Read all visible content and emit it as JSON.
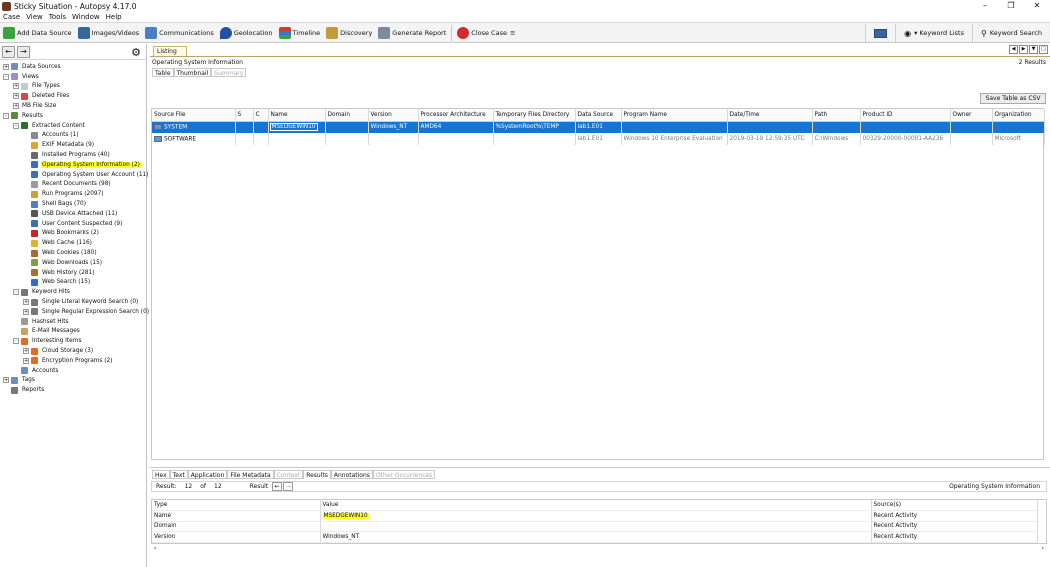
{
  "window": {
    "title": "Sticky Situation - Autopsy 4.17.0",
    "controls": [
      "–",
      "❐",
      "✕"
    ]
  },
  "menu": [
    "Case",
    "View",
    "Tools",
    "Window",
    "Help"
  ],
  "toolbar": {
    "buttons": [
      {
        "label": "Add Data Source",
        "icon": "add-data-source-icon",
        "color": "#3aa23a"
      },
      {
        "label": "Images/Videos",
        "icon": "images-icon",
        "color": "#37659e"
      },
      {
        "label": "Communications",
        "icon": "communications-icon",
        "color": "#4a7fc4"
      },
      {
        "label": "Geolocation",
        "icon": "geolocation-icon",
        "color": "#2450a4"
      },
      {
        "label": "Timeline",
        "icon": "timeline-icon",
        "color": "#d23d2a"
      },
      {
        "label": "Discovery",
        "icon": "discovery-icon",
        "color": "#c49b3a"
      },
      {
        "label": "Generate Report",
        "icon": "report-icon",
        "color": "#7c8a9a"
      },
      {
        "label": "Close Case",
        "icon": "close-case-icon",
        "color": "#d22b2b"
      }
    ],
    "keyword_lists": "Keyword Lists",
    "keyword_search": "Keyword Search"
  },
  "tree": [
    {
      "label": "Data Sources",
      "level": 0,
      "exp": "+",
      "color": "#6f8fc2"
    },
    {
      "label": "Views",
      "level": 0,
      "exp": "-",
      "color": "#9c8cc8"
    },
    {
      "label": "File Types",
      "level": 1,
      "exp": "+",
      "color": "#c9c9c9"
    },
    {
      "label": "Deleted Files",
      "level": 1,
      "exp": "+",
      "color": "#d44"
    },
    {
      "label": "MB File Size",
      "level": 1,
      "exp": "+",
      "color": ""
    },
    {
      "label": "Results",
      "level": 0,
      "exp": "-",
      "color": "#5a8c3a"
    },
    {
      "label": "Extracted Content",
      "level": 1,
      "exp": "-",
      "color": "#2f6e2f"
    },
    {
      "label": "Accounts (1)",
      "level": 2,
      "exp": "",
      "color": "#8a8a8a"
    },
    {
      "label": "EXIF Metadata (9)",
      "level": 2,
      "exp": "",
      "color": "#d9a63a"
    },
    {
      "label": "Installed Programs (40)",
      "level": 2,
      "exp": "",
      "color": "#6b6b6b"
    },
    {
      "label": "Operating System Information (2)",
      "level": 2,
      "exp": "",
      "color": "#3d6fb0",
      "hl": true
    },
    {
      "label": "Operating System User Account (11)",
      "level": 2,
      "exp": "",
      "color": "#3d6fb0"
    },
    {
      "label": "Recent Documents (98)",
      "level": 2,
      "exp": "",
      "color": "#9a9a9a"
    },
    {
      "label": "Run Programs (2097)",
      "level": 2,
      "exp": "",
      "color": "#c9a03a"
    },
    {
      "label": "Shell Bags (70)",
      "level": 2,
      "exp": "",
      "color": "#4a7fc4"
    },
    {
      "label": "USB Device Attached (11)",
      "level": 2,
      "exp": "",
      "color": "#555"
    },
    {
      "label": "User Content Suspected (9)",
      "level": 2,
      "exp": "",
      "color": "#3d6fb0"
    },
    {
      "label": "Web Bookmarks (2)",
      "level": 2,
      "exp": "",
      "color": "#c02a2a"
    },
    {
      "label": "Web Cache (116)",
      "level": 2,
      "exp": "",
      "color": "#e0b12a"
    },
    {
      "label": "Web Cookies (180)",
      "level": 2,
      "exp": "",
      "color": "#a86a2e"
    },
    {
      "label": "Web Downloads (15)",
      "level": 2,
      "exp": "",
      "color": "#7aa04a"
    },
    {
      "label": "Web History (281)",
      "level": 2,
      "exp": "",
      "color": "#a0742e"
    },
    {
      "label": "Web Search (15)",
      "level": 2,
      "exp": "",
      "color": "#2a6fd2"
    },
    {
      "label": "Keyword Hits",
      "level": 1,
      "exp": "-",
      "color": "#777"
    },
    {
      "label": "Single Literal Keyword Search (0)",
      "level": 2,
      "exp": "+",
      "color": "#777"
    },
    {
      "label": "Single Regular Expression Search (0)",
      "level": 2,
      "exp": "+",
      "color": "#777"
    },
    {
      "label": "Hashset Hits",
      "level": 1,
      "exp": "",
      "color": "#9a9a9a"
    },
    {
      "label": "E-Mail Messages",
      "level": 1,
      "exp": "",
      "color": "#c8a060"
    },
    {
      "label": "Interesting Items",
      "level": 1,
      "exp": "-",
      "color": "#e66b1f"
    },
    {
      "label": "Cloud Storage (3)",
      "level": 2,
      "exp": "+",
      "color": "#e66b1f"
    },
    {
      "label": "Encryption Programs (2)",
      "level": 2,
      "exp": "+",
      "color": "#e66b1f"
    },
    {
      "label": "Accounts",
      "level": 1,
      "exp": "",
      "color": "#6b8fc0"
    },
    {
      "label": "Tags",
      "level": 0,
      "exp": "+",
      "color": "#6b8fc0"
    },
    {
      "label": "Reports",
      "level": 0,
      "exp": "",
      "color": "#777"
    }
  ],
  "listing": {
    "tab": "Listing",
    "breadcrumb": "Operating System Information",
    "results_count": "2  Results",
    "view_tabs": [
      "Table",
      "Thumbnail",
      "Summary"
    ],
    "save_csv": "Save Table as CSV",
    "columns": [
      "Source File",
      "S",
      "C",
      "Name",
      "Domain",
      "Version",
      "Processor Architecture",
      "Temporary Files Directory",
      "Data Source",
      "Program Name",
      "Date/Time",
      "Path",
      "Product ID",
      "Owner",
      "Organization"
    ],
    "rows": [
      [
        "SYSTEM",
        "",
        "",
        "MSEDGEWIN10",
        "",
        "Windows_NT",
        "AMD64",
        "%SystemRoot%\\TEMP",
        "lab1.E01",
        "",
        "",
        "",
        "",
        "",
        ""
      ],
      [
        "SOFTWARE",
        "",
        "",
        "",
        "",
        "",
        "",
        "",
        "lab1.E01",
        "Windows 10 Enterprise Evaluation",
        "2019-03-19 12:59:35 UTC",
        "C:\\Windows",
        "00329-20000-00001-AA236",
        "",
        "Microsoft"
      ]
    ]
  },
  "detail": {
    "tabs": [
      "Hex",
      "Text",
      "Application",
      "File Metadata",
      "Context",
      "Results",
      "Annotations",
      "Other Occurrences"
    ],
    "result_label": "Result:",
    "result_current": "12",
    "result_of": "of",
    "result_total": "12",
    "result_word": "Result",
    "header_right": "Operating System Information",
    "columns": [
      "Type",
      "Value",
      "Source(s)"
    ],
    "rows": [
      [
        "Name",
        "MSEDGEWIN10",
        "Recent Activity"
      ],
      [
        "Domain",
        "",
        "Recent Activity"
      ],
      [
        "Version",
        "Windows_NT",
        "Recent Activity"
      ]
    ]
  }
}
